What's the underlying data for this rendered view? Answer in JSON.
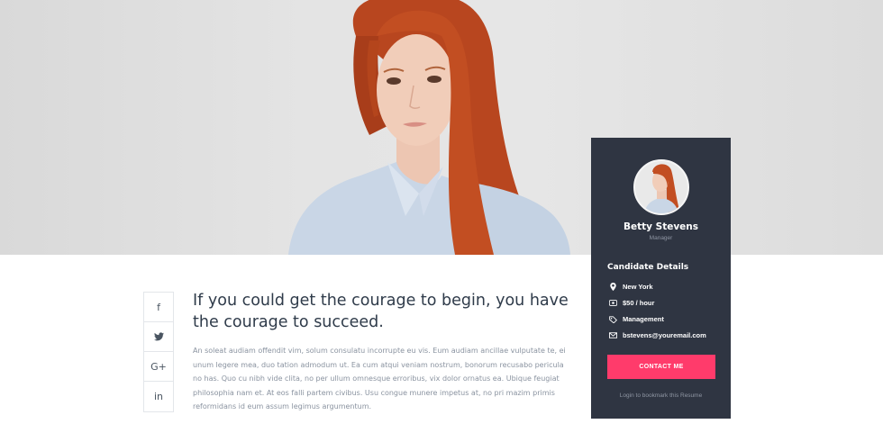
{
  "hero": {
    "photo": "portrait-photo"
  },
  "social": {
    "items": [
      {
        "icon": "facebook-icon",
        "glyph": "f"
      },
      {
        "icon": "twitter-icon",
        "glyph": "🐦"
      },
      {
        "icon": "google-plus-icon",
        "glyph": "G+"
      },
      {
        "icon": "linkedin-icon",
        "glyph": "in"
      }
    ]
  },
  "main": {
    "quote": "If you could get the courage to begin, you have the courage to succeed.",
    "body": "An soleat audiam offendit vim, solum consulatu incorrupte eu vis. Eum audiam ancillae vulputate te, ei unum legere mea, duo tation admodum ut. Ea cum atqui veniam nostrum, bonorum recusabo pericula no has. Quo cu nibh vide clita, no per ullum omnesque erroribus, vix dolor ornatus ea. Ubique feugiat philosophia nam et. At eos falli partem civibus. Usu congue munere impetus at, no pri mazim primis reformidans id eum assum legimus argumentum."
  },
  "card": {
    "name": "Betty Stevens",
    "role": "Manager",
    "details_title": "Candidate Details",
    "location": "New York",
    "rate": "$50 / hour",
    "category": "Management",
    "email": "bstevens@youremail.com",
    "contact_label": "CONTACT ME",
    "bookmark_label": "Login to bookmark this Resume"
  },
  "colors": {
    "card_bg": "#2f3542",
    "accent": "#ff3b6b",
    "quote_text": "#2f3b4a",
    "body_text": "#8a93a0"
  }
}
